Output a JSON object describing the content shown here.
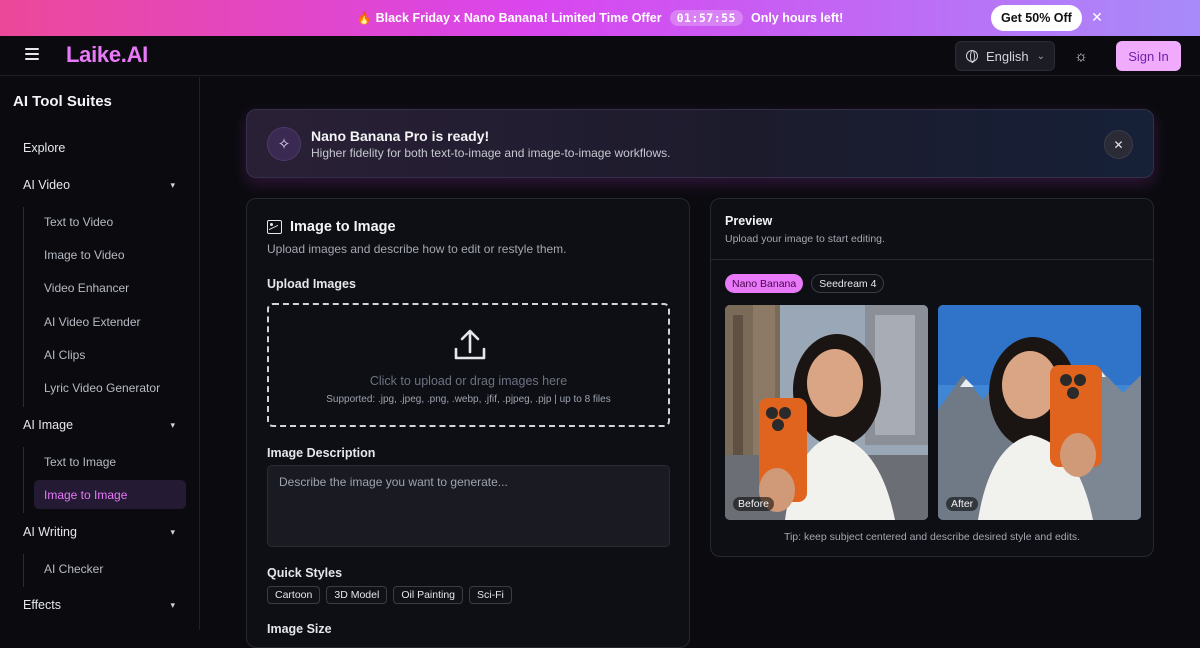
{
  "promo": {
    "text": "Black Friday x Nano Banana! Limited Time Offer",
    "timer": "01:57:55",
    "suffix": "Only hours left!",
    "cta": "Get 50% Off",
    "fire_icon": "🔥",
    "close_icon": "✕"
  },
  "nav": {
    "logo": "Laike.AI",
    "language": "English",
    "sign_in": "Sign In"
  },
  "sidebar": {
    "title": "AI Tool Suites",
    "explore": "Explore",
    "sections": {
      "video": {
        "label": "AI Video",
        "items": [
          "Text to Video",
          "Image to Video",
          "Video Enhancer",
          "AI Video Extender",
          "AI Clips",
          "Lyric Video Generator"
        ]
      },
      "image": {
        "label": "AI Image",
        "items": [
          "Text to Image",
          "Image to Image"
        ],
        "active": "Image to Image"
      },
      "writing": {
        "label": "AI Writing",
        "items": [
          "AI Checker"
        ]
      },
      "effects": {
        "label": "Effects"
      }
    }
  },
  "notice": {
    "title": "Nano Banana Pro is ready!",
    "subtitle": "Higher fidelity for both text-to-image and image-to-image workflows."
  },
  "editor": {
    "title": "Image to Image",
    "subtitle": "Upload images and describe how to edit or restyle them.",
    "upload_label": "Upload Images",
    "upload_hint": "Click to upload or drag images here",
    "upload_formats": "Supported: .jpg, .jpeg, .png, .webp, .jfif, .pjpeg, .pjp | up to 8 files",
    "description_label": "Image Description",
    "description_placeholder": "Describe the image you want to generate...",
    "quick_styles_label": "Quick Styles",
    "quick_styles": [
      "Cartoon",
      "3D Model",
      "Oil Painting",
      "Sci-Fi"
    ],
    "image_size_label": "Image Size"
  },
  "preview": {
    "title": "Preview",
    "subtitle": "Upload your image to start editing.",
    "models": [
      "Nano Banana",
      "Seedream 4"
    ],
    "selected_model": "Nano Banana",
    "before_label": "Before",
    "after_label": "After",
    "tip": "Tip: keep subject centered and describe desired style and edits."
  },
  "colors": {
    "accent": "#e879f9",
    "background": "#0b0b0f",
    "banner_start": "#ec4899",
    "banner_end": "#a78bfa"
  }
}
